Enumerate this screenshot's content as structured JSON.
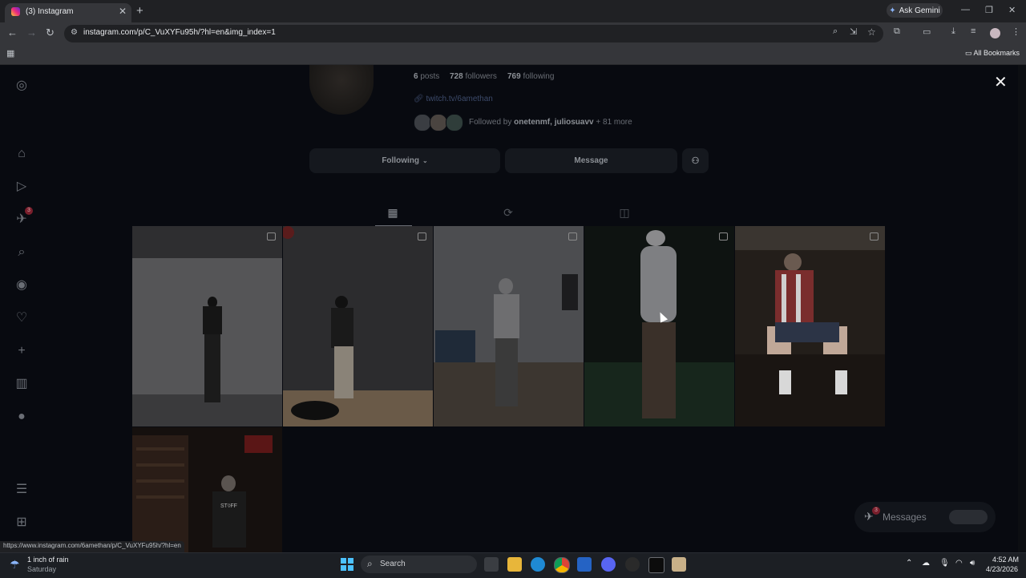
{
  "browser": {
    "tab_title": "(3) Instagram",
    "url": "instagram.com/p/C_VuXYFu95h/?hl=en&img_index=1",
    "gemini_label": "Ask Gemini",
    "all_bookmarks": "All Bookmarks",
    "status_url": "https://www.instagram.com/6amethan/p/C_VuXYFu95h/?hl=en"
  },
  "profile": {
    "posts_count": "6",
    "posts_label": "posts",
    "followers_count": "728",
    "followers_label": "followers",
    "following_count": "769",
    "following_label": "following",
    "link": "twitch.tv/6amethan",
    "followed_by_prefix": "Followed by",
    "followed_by_names": "onetenmf, juliosuavv",
    "followed_by_more": "+ 81 more",
    "following_button": "Following",
    "message_button": "Message"
  },
  "sidebar": {
    "notification_count": "3"
  },
  "messages": {
    "label": "Messages",
    "badge": "3"
  },
  "posts": [
    {
      "alt": "post-1",
      "bg": "#3b3b3d"
    },
    {
      "alt": "post-2",
      "bg": "#2a2a2c"
    },
    {
      "alt": "post-3",
      "bg": "#3e3f42"
    },
    {
      "alt": "post-4",
      "bg": "#0f1512"
    },
    {
      "alt": "post-5",
      "bg": "#1e1a17"
    },
    {
      "alt": "post-6",
      "bg": "#16100e"
    }
  ],
  "taskbar": {
    "weather_line1": "1 inch of rain",
    "weather_line2": "Saturday",
    "search_label": "Search",
    "time": "4:52 AM",
    "date": "4/23/2026"
  },
  "colors": {
    "accent_link": "#3c4a6a",
    "badge": "#7a1f2c"
  }
}
